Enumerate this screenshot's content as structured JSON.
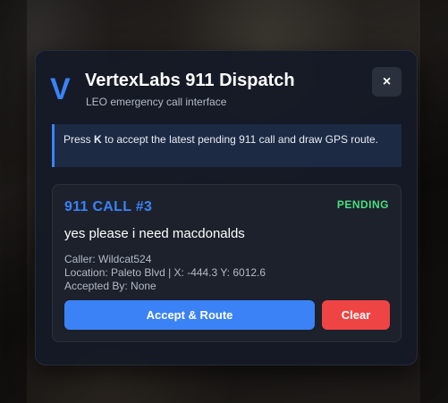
{
  "header": {
    "logo_letter": "V",
    "title": "VertexLabs 911 Dispatch",
    "subtitle": "LEO emergency call interface",
    "close_label": "×"
  },
  "notice": {
    "prefix": "Press ",
    "key": "K",
    "suffix": " to accept the latest pending 911 call and draw GPS route."
  },
  "call": {
    "title": "911 CALL #3",
    "status": "PENDING",
    "message": "yes please i need macdonalds",
    "caller": "Caller: Wildcat524",
    "location": "Location: Paleto Blvd | X: -444.3 Y: 6012.6",
    "accepted_by": "Accepted By: None"
  },
  "actions": {
    "accept_label": "Accept & Route",
    "clear_label": "Clear"
  },
  "colors": {
    "accent": "#3b82f6",
    "pending": "#4ade80",
    "danger": "#ef4444"
  }
}
